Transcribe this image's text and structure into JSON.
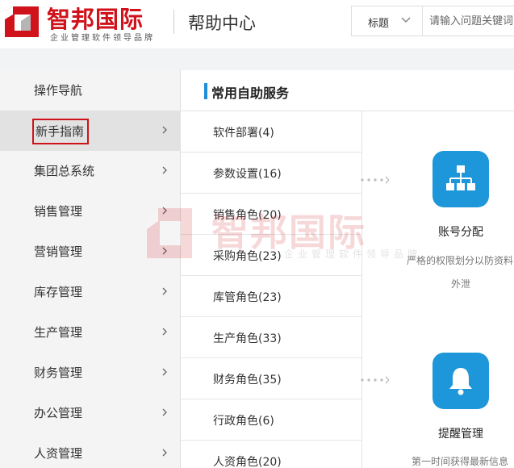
{
  "header": {
    "brand_name": "智邦国际",
    "brand_slogan": "企业管理软件领导品牌",
    "title": "帮助中心",
    "search": {
      "field_selected": "标题",
      "placeholder": "请输入问题关键词"
    }
  },
  "sidebar": {
    "items": [
      {
        "label": "操作导航",
        "has_chevron": false
      },
      {
        "label": "新手指南",
        "has_chevron": true,
        "active": true
      },
      {
        "label": "集团总系统",
        "has_chevron": true
      },
      {
        "label": "销售管理",
        "has_chevron": true
      },
      {
        "label": "营销管理",
        "has_chevron": true
      },
      {
        "label": "库存管理",
        "has_chevron": true
      },
      {
        "label": "生产管理",
        "has_chevron": true
      },
      {
        "label": "财务管理",
        "has_chevron": true
      },
      {
        "label": "办公管理",
        "has_chevron": true
      },
      {
        "label": "人资管理",
        "has_chevron": true
      }
    ]
  },
  "main": {
    "section_title": "常用自助服务",
    "guide_list": [
      "软件部署(4)",
      "参数设置(16)",
      "销售角色(20)",
      "采购角色(23)",
      "库管角色(23)",
      "生产角色(33)",
      "财务角色(35)",
      "行政角色(6)",
      "人资角色(20)"
    ],
    "cards": [
      {
        "icon": "org-chart-icon",
        "title": "账号分配",
        "desc_line1": "严格的权限划分以防资料",
        "desc_line2": "外泄"
      },
      {
        "icon": "bell-icon",
        "title": "提醒管理",
        "desc_line1": "第一时间获得最新信息"
      }
    ]
  },
  "colors": {
    "brand_red": "#d0121b",
    "accent_blue": "#1d97d9"
  }
}
